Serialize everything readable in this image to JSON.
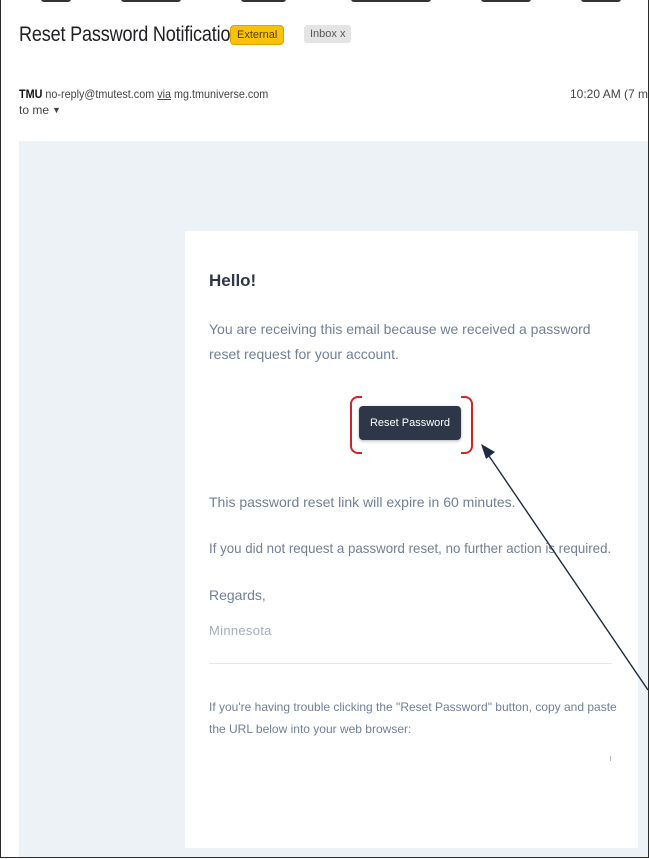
{
  "email": {
    "subject": "Reset Password Notification",
    "labels": {
      "external": "External",
      "inbox": "Inbox x"
    },
    "sender": {
      "name": "TMU",
      "address": "no-reply@tmutest.com",
      "via_word": "via",
      "via_domain": "mg.tmuniverse.com"
    },
    "time": "10:20 AM (7 m",
    "recipient": "to me"
  },
  "message": {
    "greeting": "Hello!",
    "intro": "You are receiving this email because we received a password reset request for your account.",
    "button_label": "Reset Password",
    "expiry": "This password reset link will expire in 60 minutes.",
    "no_action": "If you did not request a password reset, no further action is required.",
    "regards": "Regards,",
    "signature": "Minnesota",
    "subcopy": "If you're having trouble clicking the \"Reset Password\" button, copy and paste the URL below into your web browser:"
  },
  "colors": {
    "highlight": "#d42323",
    "button": "#2d3748",
    "email_background": "#edf2f7",
    "external_badge": "#f9c20a"
  },
  "icons": {
    "recipient_dropdown": "caret-down-icon"
  }
}
